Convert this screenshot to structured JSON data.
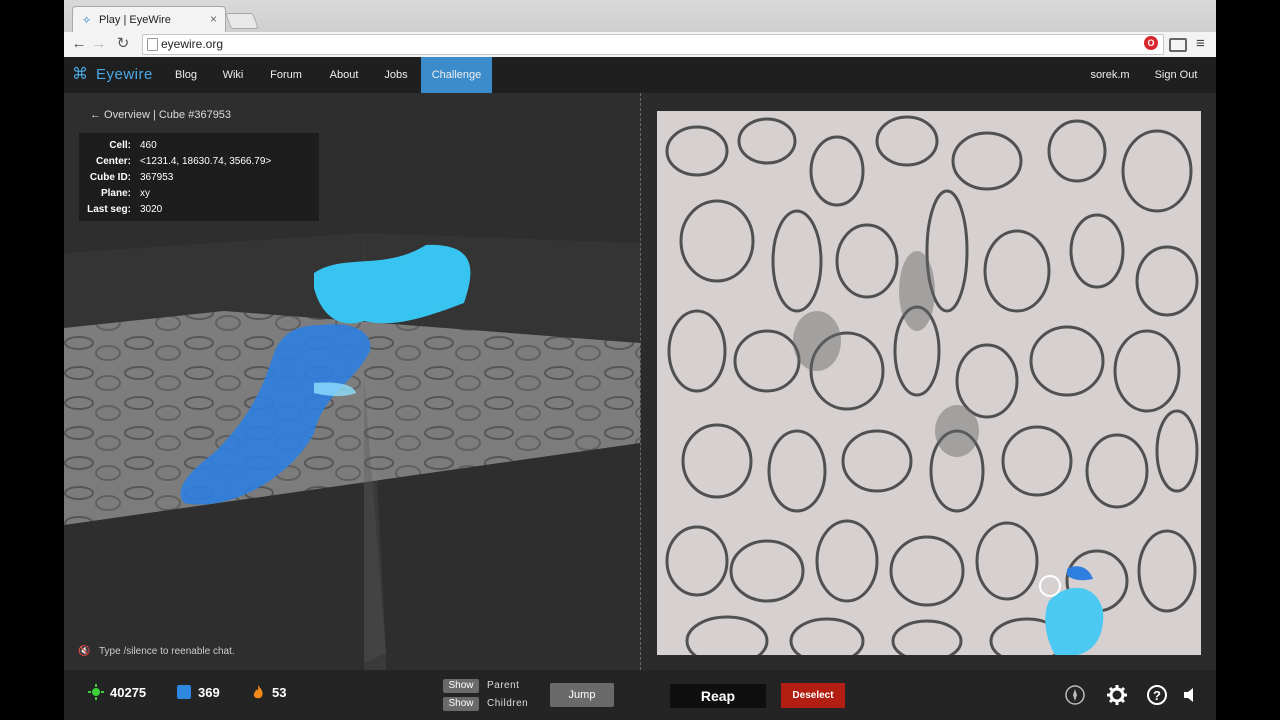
{
  "browser": {
    "tab_title": "Play | EyeWire",
    "tab_close": "×",
    "url": "eyewire.org",
    "back_glyph": "←",
    "forward_glyph": "→",
    "reload_glyph": "↻",
    "star_glyph": "☆",
    "menu_glyph": "≡",
    "ext_label": "O"
  },
  "nav": {
    "logo_text": "Eyewire",
    "links": [
      "Blog",
      "Wiki",
      "Forum",
      "About",
      "Jobs",
      "Challenge"
    ],
    "active": "Challenge",
    "user": "sorek.m",
    "sign_out": "Sign Out"
  },
  "overview": {
    "breadcrumb": "← Overview | Cube #367953",
    "fields": [
      {
        "key": "Cell:",
        "value": "460"
      },
      {
        "key": "Center:",
        "value": "<1231.4, 18630.74, 3566.79>"
      },
      {
        "key": "Cube ID:",
        "value": "367953"
      },
      {
        "key": "Plane:",
        "value": "xy"
      },
      {
        "key": "Last seg:",
        "value": "3020"
      }
    ],
    "chat_notice": "Type /silence to reenable chat."
  },
  "stats": {
    "points": "40275",
    "cubes": "369",
    "streak": "53"
  },
  "controls": {
    "show_label": "Show",
    "parent_label": "Parent",
    "children_label": "Children",
    "jump_label": "Jump",
    "reap_label": "Reap",
    "deselect_label": "Deselect"
  },
  "icons": {
    "points": "green-starburst-icon",
    "cubes": "blue-cube-icon",
    "streak": "orange-flame-icon",
    "compass": "compass-icon",
    "settings": "gear-icon",
    "help": "help-icon",
    "sound": "speaker-icon",
    "mute": "muted-speaker-icon"
  },
  "colors": {
    "accent": "#3c8ccc",
    "segment_dark": "#2f7fe0",
    "segment_light": "#38c4f0",
    "deselect": "#b31e12"
  }
}
